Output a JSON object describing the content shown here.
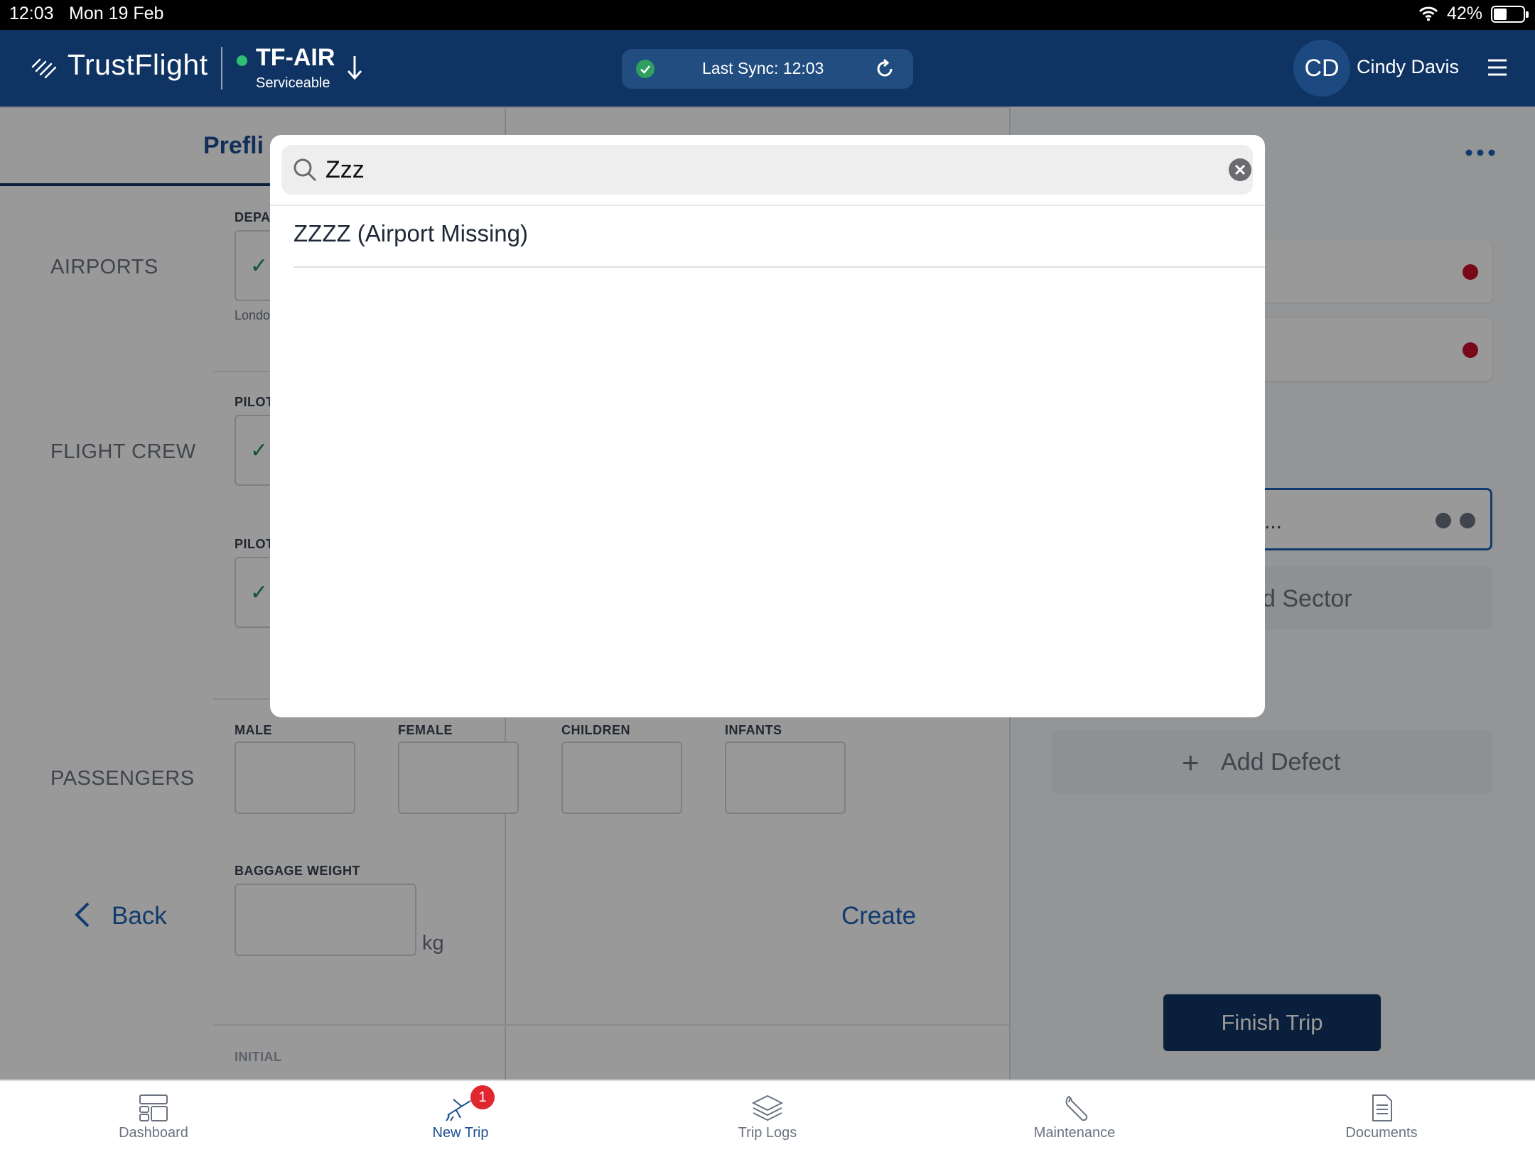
{
  "status_bar": {
    "time": "12:03",
    "date": "Mon 19 Feb",
    "battery": "42%"
  },
  "header": {
    "brand": "TrustFlight",
    "aircraft": {
      "registration": "TF-AIR",
      "status": "Serviceable",
      "status_color": "#2fbf71"
    },
    "sync": {
      "label": "Last Sync: 12:03",
      "ok_color": "#2f9e5e"
    },
    "user": {
      "initials": "CD",
      "name": "Cindy Davis"
    }
  },
  "page": {
    "tab_label": "Prefli",
    "sections": {
      "airports": "AIRPORTS",
      "flight_crew": "FLIGHT CREW",
      "passengers": "PASSENGERS"
    },
    "fields": {
      "departure_label": "DEPA",
      "departure_sub": "Londo",
      "pilot1_label": "PILOT",
      "pilot2_label": "PILOT",
      "male": "MALE",
      "female": "FEMALE",
      "children": "CHILDREN",
      "infants": "INFANTS",
      "baggage_weight": "BAGGAGE WEIGHT",
      "baggage_unit": "kg",
      "initial": "INITIAL"
    },
    "back_label": "Back",
    "create_label": "Create"
  },
  "right_panel": {
    "selected_text": "...",
    "add_sector_label": "d Sector",
    "add_defect_label": "Add Defect",
    "finish_trip_label": "Finish Trip"
  },
  "search_modal": {
    "query": "Zzz",
    "results": [
      "ZZZZ (Airport Missing)"
    ]
  },
  "tab_bar": {
    "items": [
      {
        "label": "Dashboard",
        "icon": "dashboard-icon"
      },
      {
        "label": "New Trip",
        "icon": "plane-icon",
        "badge": "1",
        "active": true
      },
      {
        "label": "Trip Logs",
        "icon": "layers-icon"
      },
      {
        "label": "Maintenance",
        "icon": "wrench-icon"
      },
      {
        "label": "Documents",
        "icon": "document-icon"
      }
    ]
  },
  "colors": {
    "header_bg": "#0f3463",
    "accent": "#1d63b8",
    "badge": "#e0262f"
  }
}
